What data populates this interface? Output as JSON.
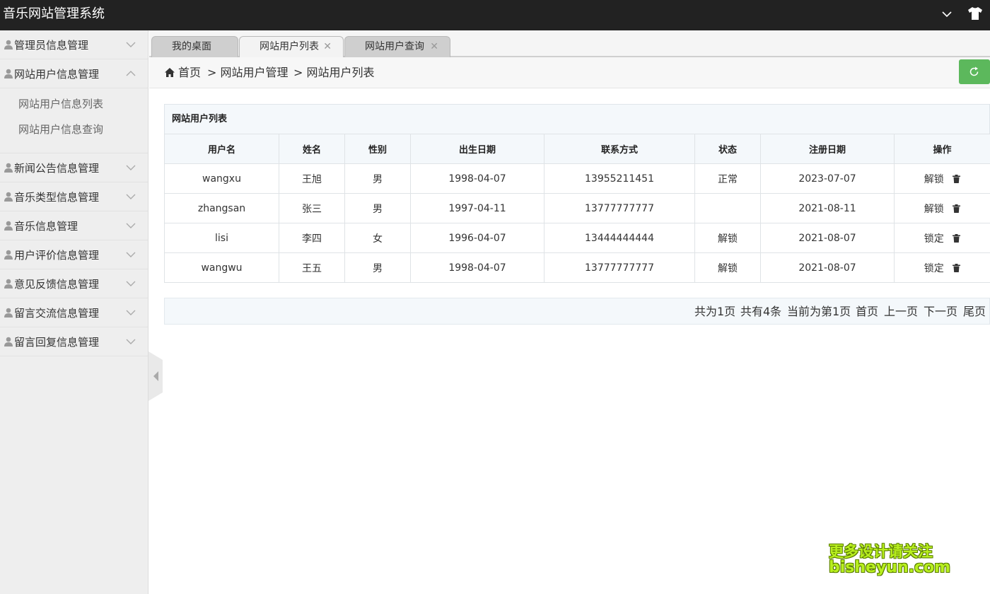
{
  "header": {
    "title": "音乐网站管理系统"
  },
  "sidebar": {
    "groups": [
      {
        "label": "管理员信息管理"
      },
      {
        "label": "网站用户信息管理"
      },
      {
        "label": "新闻公告信息管理"
      },
      {
        "label": "音乐类型信息管理"
      },
      {
        "label": "音乐信息管理"
      },
      {
        "label": "用户评价信息管理"
      },
      {
        "label": "意见反馈信息管理"
      },
      {
        "label": "留言交流信息管理"
      },
      {
        "label": "留言回复信息管理"
      }
    ],
    "sub_items": [
      {
        "label": "网站用户信息列表"
      },
      {
        "label": "网站用户信息查询"
      }
    ]
  },
  "tabs": [
    {
      "label": "我的桌面"
    },
    {
      "label": "网站用户列表"
    },
    {
      "label": "网站用户查询"
    }
  ],
  "breadcrumb": {
    "home": "首页",
    "level1": "> 网站用户管理",
    "level2": "> 网站用户列表"
  },
  "table": {
    "caption": "网站用户列表",
    "headers": [
      "用户名",
      "姓名",
      "性别",
      "出生日期",
      "联系方式",
      "状态",
      "注册日期",
      "操作"
    ],
    "rows": [
      {
        "username": "wangxu",
        "name": "王旭",
        "gender": "男",
        "birth": "1998-04-07",
        "phone": "13955211451",
        "status": "正常",
        "reg": "2023-07-07",
        "action": "解锁"
      },
      {
        "username": "zhangsan",
        "name": "张三",
        "gender": "男",
        "birth": "1997-04-11",
        "phone": "13777777777",
        "status": "",
        "reg": "2021-08-11",
        "action": "解锁"
      },
      {
        "username": "lisi",
        "name": "李四",
        "gender": "女",
        "birth": "1996-04-07",
        "phone": "13444444444",
        "status": "解锁",
        "reg": "2021-08-07",
        "action": "锁定"
      },
      {
        "username": "wangwu",
        "name": "王五",
        "gender": "男",
        "birth": "1998-04-07",
        "phone": "13777777777",
        "status": "解锁",
        "reg": "2021-08-07",
        "action": "锁定"
      }
    ]
  },
  "pager": {
    "total_pages": "共为1页",
    "total_items": "共有4条",
    "current": "当前为第1页",
    "first": "首页",
    "prev": "上一页",
    "next": "下一页",
    "last": "尾页"
  },
  "watermark": {
    "line1": "更多设计请关注",
    "line2": "bisheyun.com"
  },
  "colors": {
    "header_bg": "#222222",
    "refresh_button": "#5cb85c",
    "watermark": "#b8ef1f"
  }
}
